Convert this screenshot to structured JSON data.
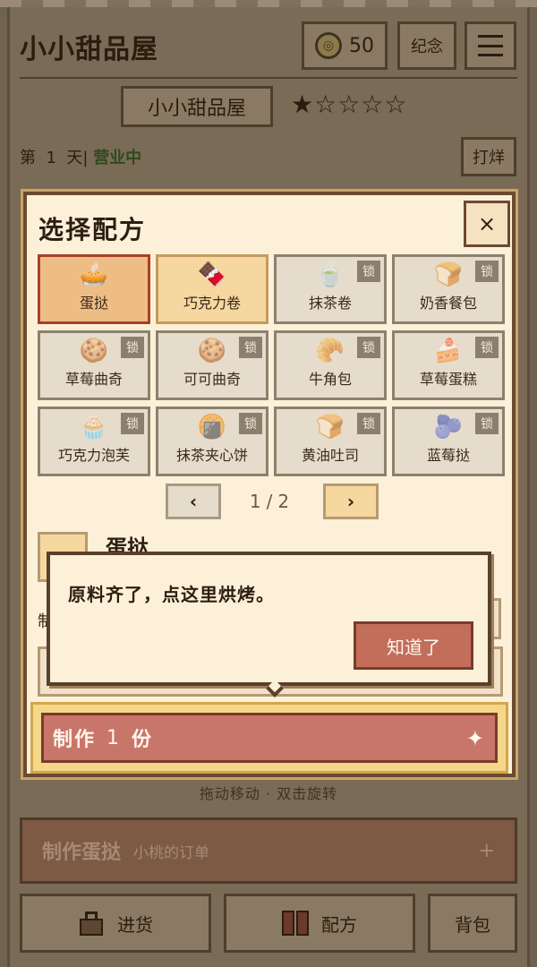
{
  "header": {
    "title": "小小甜品屋",
    "coins": "50",
    "coin_glyph": "◎",
    "souvenir_label": "纪念",
    "menu_icon": "menu-icon"
  },
  "shop": {
    "name": "小小甜品屋",
    "stars": "★☆☆☆☆",
    "rating": 1,
    "max_rating": 5
  },
  "status": {
    "day_prefix": "第",
    "day_num": "1",
    "day_suffix": "天",
    "state": "营业中",
    "close_label": "打烊"
  },
  "hint": "拖动移动 · 双击旋转",
  "order": {
    "title": "制作蛋挞",
    "customer": "小桃的订单",
    "plus": "+"
  },
  "bottom_nav": {
    "stock": "进货",
    "recipes": "配方",
    "bag": "背包"
  },
  "modal": {
    "title": "选择配方",
    "close": "×",
    "lock_label": "锁",
    "recipes": [
      {
        "name": "蛋挞",
        "icon": "egg-tart-icon",
        "glyph": "🥧",
        "state": "selected"
      },
      {
        "name": "巧克力卷",
        "icon": "chocolate-roll-icon",
        "glyph": "🍫",
        "state": "unlocked"
      },
      {
        "name": "抹茶卷",
        "icon": "matcha-roll-icon",
        "glyph": "🍵",
        "state": "locked"
      },
      {
        "name": "奶香餐包",
        "icon": "milk-bun-icon",
        "glyph": "🍞",
        "state": "locked"
      },
      {
        "name": "草莓曲奇",
        "icon": "strawberry-cookie-icon",
        "glyph": "🍪",
        "state": "locked"
      },
      {
        "name": "可可曲奇",
        "icon": "cocoa-cookie-icon",
        "glyph": "🍪",
        "state": "locked"
      },
      {
        "name": "牛角包",
        "icon": "croissant-icon",
        "glyph": "🥐",
        "state": "locked"
      },
      {
        "name": "草莓蛋糕",
        "icon": "strawberry-cake-icon",
        "glyph": "🍰",
        "state": "locked"
      },
      {
        "name": "巧克力泡芙",
        "icon": "chocolate-puff-icon",
        "glyph": "🧁",
        "state": "locked"
      },
      {
        "name": "抹茶夹心饼",
        "icon": "matcha-sandwich-icon",
        "glyph": "🍘",
        "state": "locked"
      },
      {
        "name": "黄油吐司",
        "icon": "butter-toast-icon",
        "glyph": "🍞",
        "state": "locked"
      },
      {
        "name": "蓝莓挞",
        "icon": "blueberry-tart-icon",
        "glyph": "🫐",
        "state": "locked"
      }
    ],
    "pager": {
      "prev": "‹",
      "next": "›",
      "current": "1",
      "separator": "/",
      "total": "2"
    },
    "detail": {
      "name": "蛋挞",
      "fragment": "制"
    },
    "make": {
      "prefix": "制作",
      "qty": "1",
      "unit": "份",
      "spark": "✦"
    }
  },
  "tooltip": {
    "text": "原料齐了，点这里烘烤。",
    "button": "知道了"
  }
}
